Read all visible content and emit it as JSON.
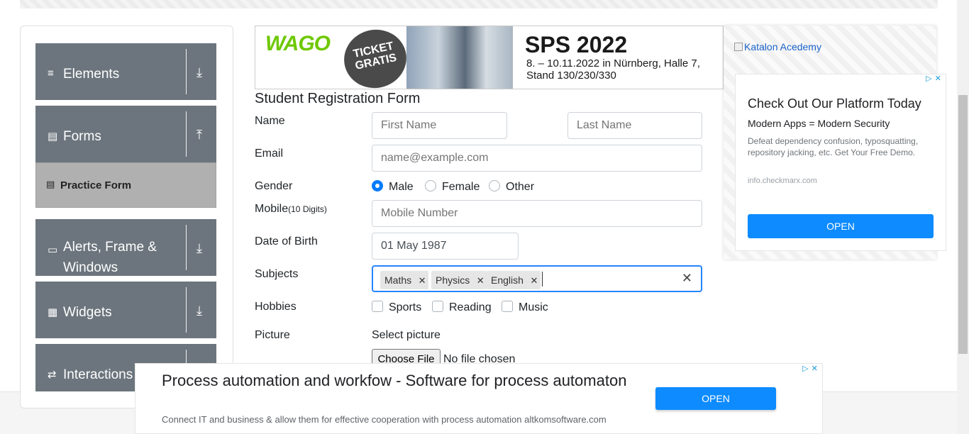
{
  "sidebar": {
    "groups": [
      {
        "label": "Elements",
        "icon": "≡",
        "arrow": "⤓"
      },
      {
        "label": "Forms",
        "icon": "▤",
        "arrow": "⤒"
      },
      {
        "label": "Alerts, Frame & Windows",
        "icon": "▭",
        "arrow": "⤓"
      },
      {
        "label": "Widgets",
        "icon": "▦",
        "arrow": "⤓"
      },
      {
        "label": "Interactions",
        "icon": "⇄",
        "arrow": "⤓"
      }
    ],
    "active_item": {
      "label": "Practice Form",
      "icon": "▤"
    }
  },
  "banner": {
    "brand": "WAGO",
    "ticket": "TICKET GRATIS",
    "title": "SPS 2022",
    "subtitle": "8. – 10.11.2022 in Nürnberg, Halle 7, Stand 130/230/330"
  },
  "form": {
    "title": "Student Registration Form",
    "name_label": "Name",
    "first_name_placeholder": "First Name",
    "last_name_placeholder": "Last Name",
    "email_label": "Email",
    "email_placeholder": "name@example.com",
    "gender_label": "Gender",
    "gender_options": [
      "Male",
      "Female",
      "Other"
    ],
    "gender_selected": "Male",
    "mobile_label": "Mobile",
    "mobile_hint": "(10 Digits)",
    "mobile_placeholder": "Mobile Number",
    "dob_label": "Date of Birth",
    "dob_value": "01 May 1987",
    "subjects_label": "Subjects",
    "subjects": [
      "Maths",
      "Physics",
      "English"
    ],
    "hobbies_label": "Hobbies",
    "hobbies": [
      "Sports",
      "Reading",
      "Music"
    ],
    "picture_label": "Picture",
    "select_picture": "Select picture",
    "choose_file": "Choose File",
    "no_file": "No file chosen"
  },
  "side_ad": {
    "katalon": "Katalon Acedemy",
    "headline": "Check Out Our Platform Today",
    "subhead": "Modern Apps = Modern Security",
    "body": "Defeat dependency confusion, typosquatting, repository jacking, etc. Get Your Free Demo.",
    "url": "info.checkmarx.com",
    "open": "OPEN"
  },
  "bottom_ad": {
    "headline": "Process automation and workfow - Software for process automaton",
    "body": "Connect IT and business & allow them for effective cooperation with process automation altkomsoftware.com",
    "open": "OPEN"
  },
  "colors": {
    "sidebar_bg": "#6c757d",
    "accent": "#007bff",
    "ad_button": "#0d8bff",
    "focus": "#2684ff"
  }
}
